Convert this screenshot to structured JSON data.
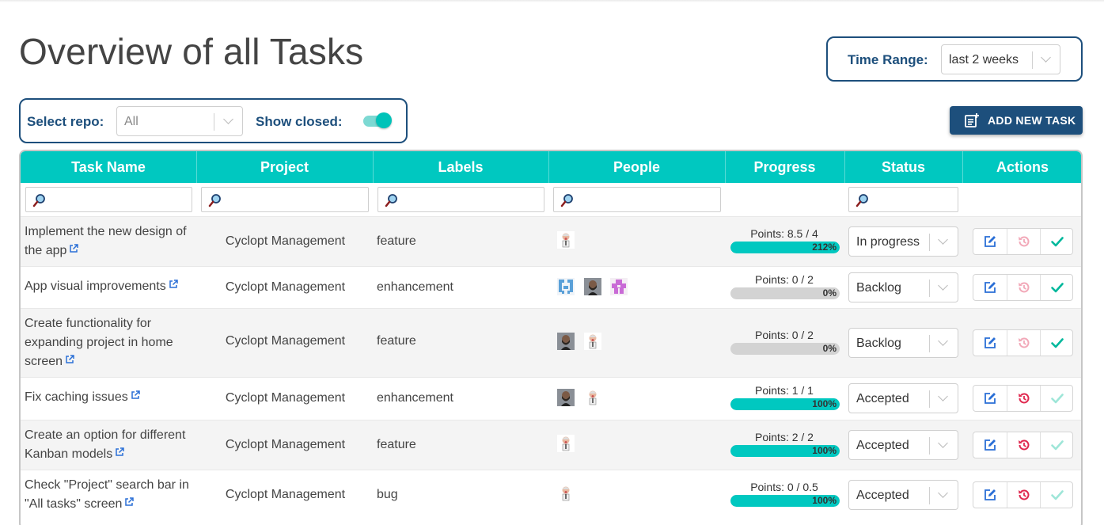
{
  "page": {
    "title": "Overview of all Tasks"
  },
  "time_range": {
    "label": "Time Range:",
    "value": "last 2 weeks"
  },
  "filters": {
    "repo_label": "Select repo:",
    "repo_value": "All",
    "show_closed_label": "Show closed:",
    "show_closed": true
  },
  "add_button": {
    "label": "ADD NEW TASK",
    "icon": "add-task-icon"
  },
  "colors": {
    "accent": "#00c8c0",
    "brand": "#1d4f7c",
    "edit": "#2a6fd6",
    "revert": "#e0284f",
    "confirm": "#00b89c"
  },
  "table": {
    "headers": [
      "Task Name",
      "Project",
      "Labels",
      "People",
      "Progress",
      "Status",
      "Actions"
    ],
    "rows": [
      {
        "name": "Implement the new design of the app",
        "project": "Cyclopt Management",
        "label": "feature",
        "people": [
          "avatar-old-man"
        ],
        "points": "Points: 8.5 / 4",
        "progress": 212,
        "percent": "212%",
        "status": "In progress",
        "revert_enabled": false,
        "confirm_enabled": true
      },
      {
        "name": "App visual improvements",
        "project": "Cyclopt Management",
        "label": "enhancement",
        "people": [
          "avatar-blue-pattern",
          "avatar-bearded-man",
          "avatar-pink-pattern"
        ],
        "points": "Points: 0 / 2",
        "progress": 0,
        "percent": "0%",
        "status": "Backlog",
        "revert_enabled": false,
        "confirm_enabled": true
      },
      {
        "name": "Create functionality for expanding project in home screen",
        "project": "Cyclopt Management",
        "label": "feature",
        "people": [
          "avatar-bearded-man",
          "avatar-old-man"
        ],
        "points": "Points: 0 / 2",
        "progress": 0,
        "percent": "0%",
        "status": "Backlog",
        "revert_enabled": false,
        "confirm_enabled": true
      },
      {
        "name": "Fix caching issues",
        "project": "Cyclopt Management",
        "label": "enhancement",
        "people": [
          "avatar-bearded-man",
          "avatar-old-man"
        ],
        "points": "Points: 1 / 1",
        "progress": 100,
        "percent": "100%",
        "status": "Accepted",
        "revert_enabled": true,
        "confirm_enabled": false
      },
      {
        "name": "Create an option for different Kanban models",
        "project": "Cyclopt Management",
        "label": "feature",
        "people": [
          "avatar-old-man"
        ],
        "points": "Points: 2 / 2",
        "progress": 100,
        "percent": "100%",
        "status": "Accepted",
        "revert_enabled": true,
        "confirm_enabled": false
      },
      {
        "name": "Check \"Project\" search bar in \"All tasks\" screen",
        "project": "Cyclopt Management",
        "label": "bug",
        "people": [
          "avatar-old-man"
        ],
        "points": "Points: 0 / 0.5",
        "progress": 100,
        "percent": "100%",
        "status": "Accepted",
        "revert_enabled": true,
        "confirm_enabled": false
      }
    ]
  }
}
